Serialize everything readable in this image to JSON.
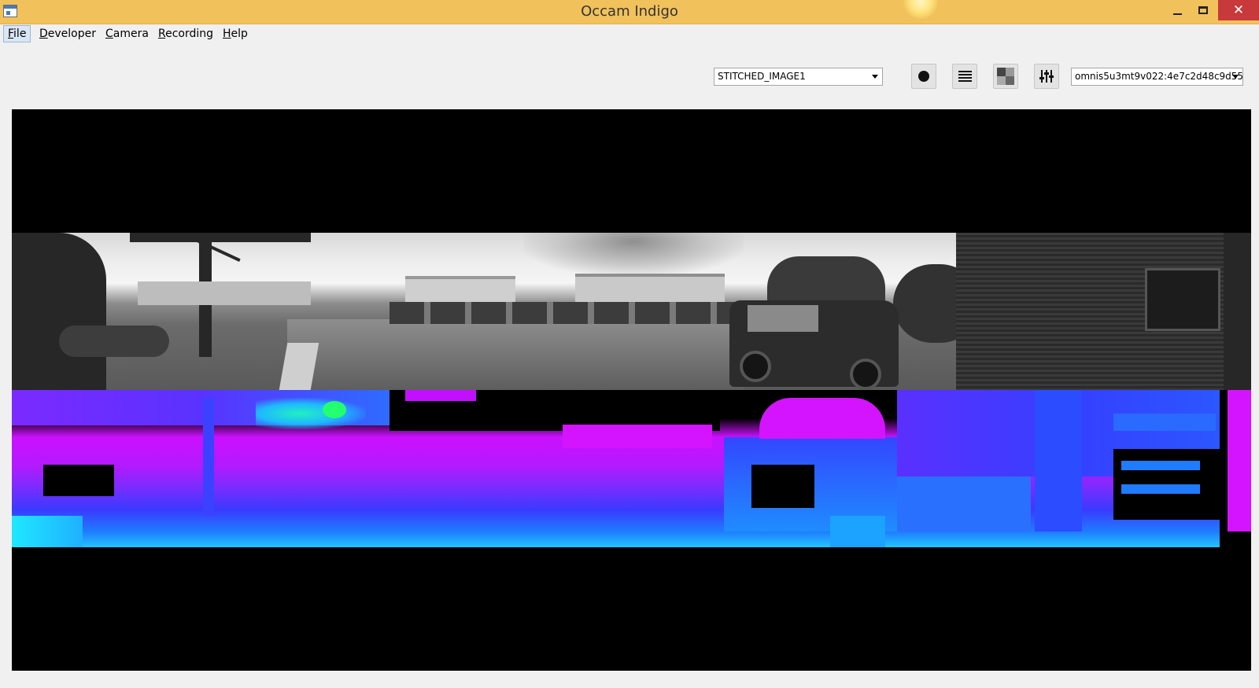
{
  "window": {
    "title": "Occam Indigo",
    "close_glyph": "✕"
  },
  "menu": [
    {
      "label": "File",
      "underline": "F",
      "rest": "ile"
    },
    {
      "label": "Developer",
      "underline": "D",
      "rest": "eveloper"
    },
    {
      "label": "Camera",
      "underline": "C",
      "rest": "amera"
    },
    {
      "label": "Recording",
      "underline": "R",
      "rest": "ecording"
    },
    {
      "label": "Help",
      "underline": "H",
      "rest": "elp"
    }
  ],
  "toolbar": {
    "stream_selected": "STITCHED_IMAGE1",
    "device_selected": "omnis5u3mt9v022:4e7c2d48c9d55"
  },
  "icons": {
    "record": "record-icon",
    "list": "list-icon",
    "checker": "checkerboard-icon",
    "settings": "sliders-icon"
  },
  "colors": {
    "titlebar": "#f1c15c",
    "close": "#c7393a",
    "depth_magenta": "#cc10ff",
    "depth_blue": "#3a3aff",
    "depth_cyan": "#22c4ff"
  }
}
